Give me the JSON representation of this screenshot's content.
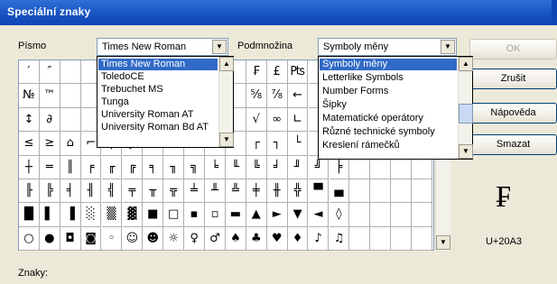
{
  "title": "Speciální znaky",
  "font_label": "Písmo",
  "font_value": "Times New Roman",
  "subset_label": "Podmnožina",
  "subset_value": "Symboly měny",
  "buttons": {
    "ok": "OK",
    "cancel": "Zrušit",
    "help": "Nápověda",
    "clear": "Smazat"
  },
  "font_list": [
    "Times New Roman",
    "ToledoCE",
    "Trebuchet MS",
    "Tunga",
    "University Roman AT",
    "University Roman Bd AT"
  ],
  "subset_list": [
    "Symboly měny",
    "Letterlike Symbols",
    "Number Forms",
    "Šipky",
    "Matematické operátory",
    "Různé technické symboly",
    "Kreslení rámečků"
  ],
  "preview_char": "₣",
  "unicode_code": "U+20A3",
  "chars_label": "Znaky:",
  "grid": [
    [
      "′",
      "″",
      "",
      "",
      "",
      "",
      "",
      "",
      "",
      "",
      "",
      "₣",
      "£",
      "₧",
      "",
      "",
      "",
      "",
      "",
      ""
    ],
    [
      "№",
      "™",
      "",
      "",
      "",
      "",
      "",
      "",
      "",
      "",
      "",
      "⅝",
      "⅞",
      "←",
      "",
      "",
      "",
      "",
      "",
      ""
    ],
    [
      "↕",
      "∂",
      "",
      "",
      "",
      "",
      "",
      "",
      "",
      "",
      "",
      "√",
      "∞",
      "∟",
      "",
      "",
      "",
      "",
      "",
      ""
    ],
    [
      "≤",
      "≥",
      "⌂",
      "⌐",
      "⌠",
      "⌡",
      "",
      "",
      "",
      "",
      "",
      "┌",
      "┐",
      "└",
      "",
      "",
      "",
      "",
      "",
      ""
    ],
    [
      "┼",
      "═",
      "║",
      "╒",
      "╓",
      "╔",
      "╕",
      "╖",
      "╗",
      "╘",
      "╙",
      "╚",
      "╛",
      "╜",
      "╝",
      "╞",
      "",
      "",
      "",
      ""
    ],
    [
      "╟",
      "╠",
      "╡",
      "╢",
      "╣",
      "╤",
      "╥",
      "╦",
      "╧",
      "╨",
      "╩",
      "╪",
      "╫",
      "╬",
      "▀",
      "▄",
      "",
      "",
      "",
      ""
    ],
    [
      "█",
      "▌",
      "▐",
      "░",
      "▒",
      "▓",
      "■",
      "□",
      "▪",
      "▫",
      "▬",
      "▲",
      "►",
      "▼",
      "◄",
      "◊",
      "",
      "",
      "",
      ""
    ],
    [
      "○",
      "●",
      "◘",
      "◙",
      "◦",
      "☺",
      "☻",
      "☼",
      "♀",
      "♂",
      "♠",
      "♣",
      "♥",
      "♦",
      "♪",
      "♫",
      "",
      "",
      "",
      ""
    ]
  ]
}
